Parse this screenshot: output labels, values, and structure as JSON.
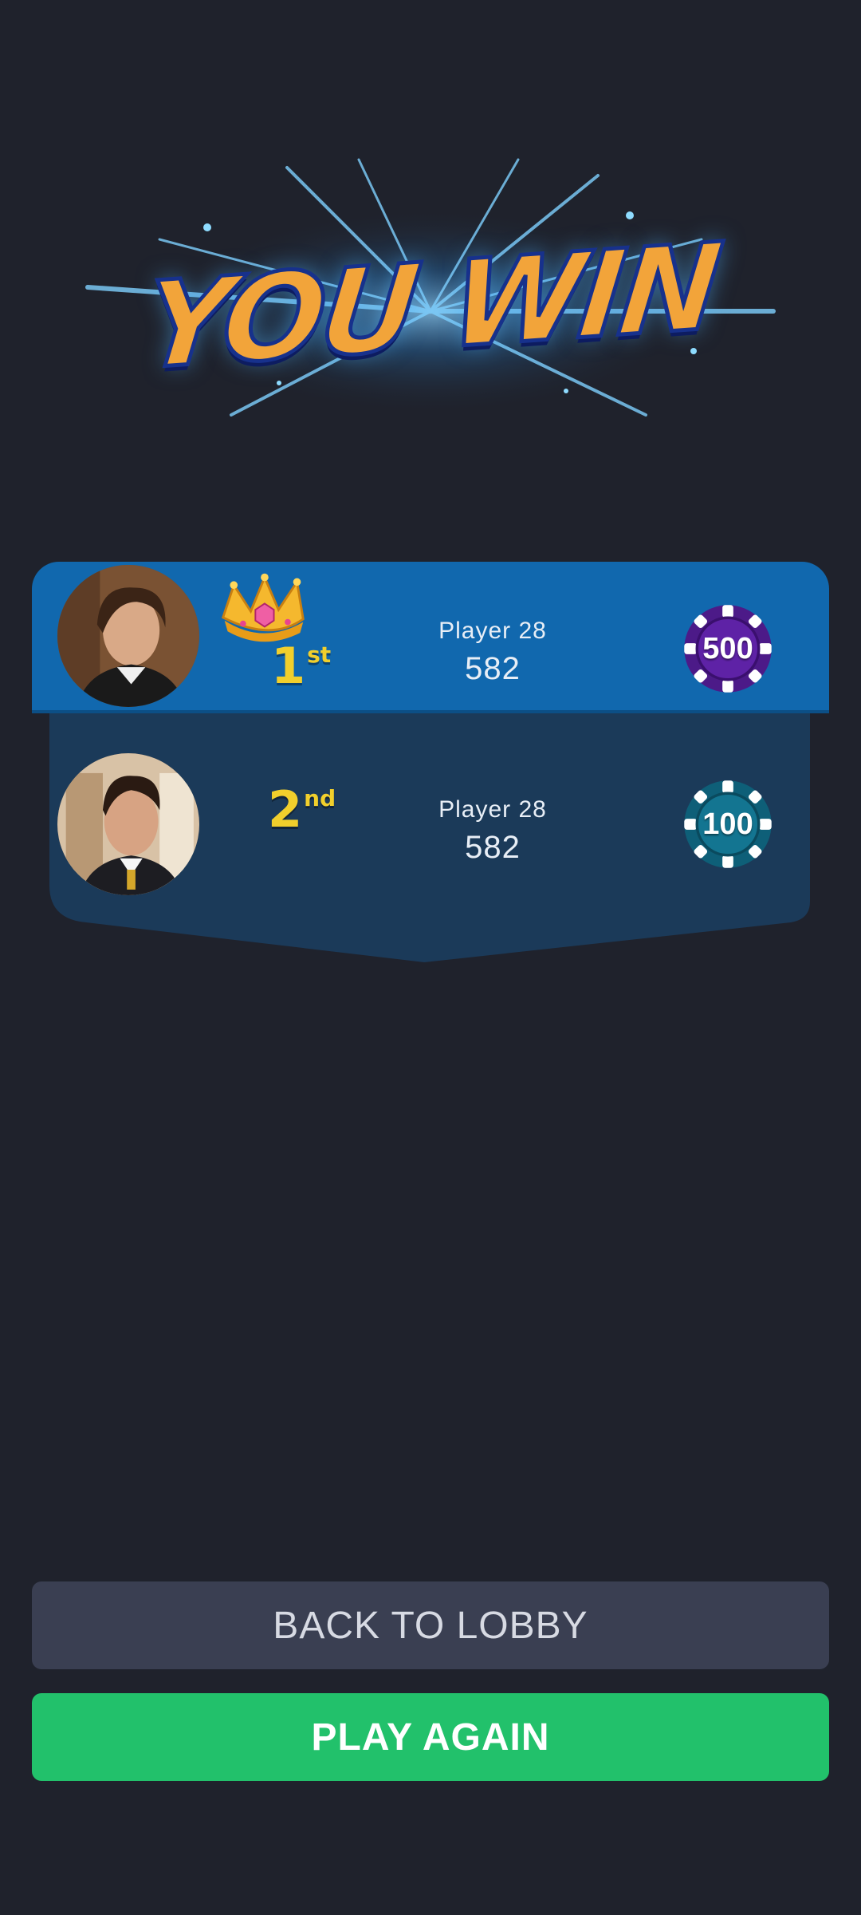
{
  "banner": {
    "title": "YOU WIN"
  },
  "leaderboard": {
    "players": [
      {
        "rank_number": "1",
        "rank_suffix": "st",
        "name": "Player 28",
        "score": "582",
        "chip_value": "500",
        "chip_color": "#4c1a88",
        "crown": "crown-icon"
      },
      {
        "rank_number": "2",
        "rank_suffix": "nd",
        "name": "Player 28",
        "score": "582",
        "chip_value": "100",
        "chip_color": "#0e5f78"
      }
    ]
  },
  "actions": {
    "back_to_lobby_label": "BACK TO LOBBY",
    "play_again_label": "PLAY AGAIN"
  },
  "colors": {
    "background": "#1f222c",
    "first_row": "#1168ae",
    "panel": "#1b3a59",
    "rank_gold": "#f1cf2c",
    "play_again": "#22c16b",
    "back_to_lobby": "#3a3f52"
  }
}
